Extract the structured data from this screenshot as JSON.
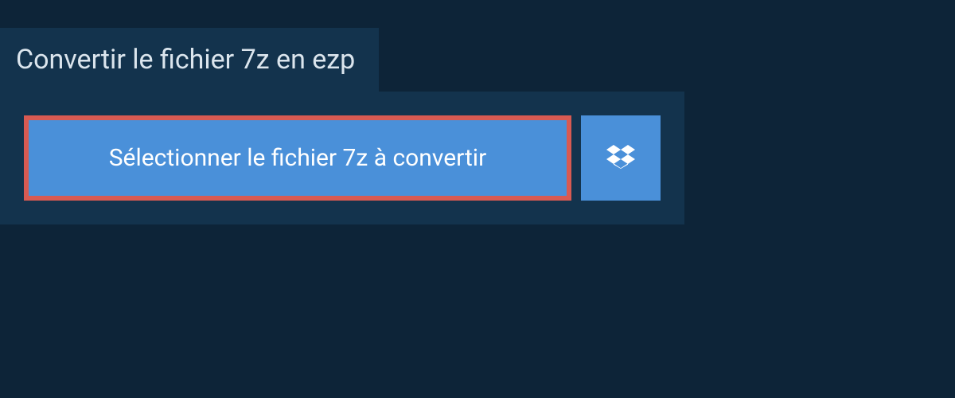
{
  "header": {
    "title": "Convertir le fichier 7z en ezp"
  },
  "upload": {
    "select_button_label": "Sélectionner le fichier 7z à convertir"
  }
}
